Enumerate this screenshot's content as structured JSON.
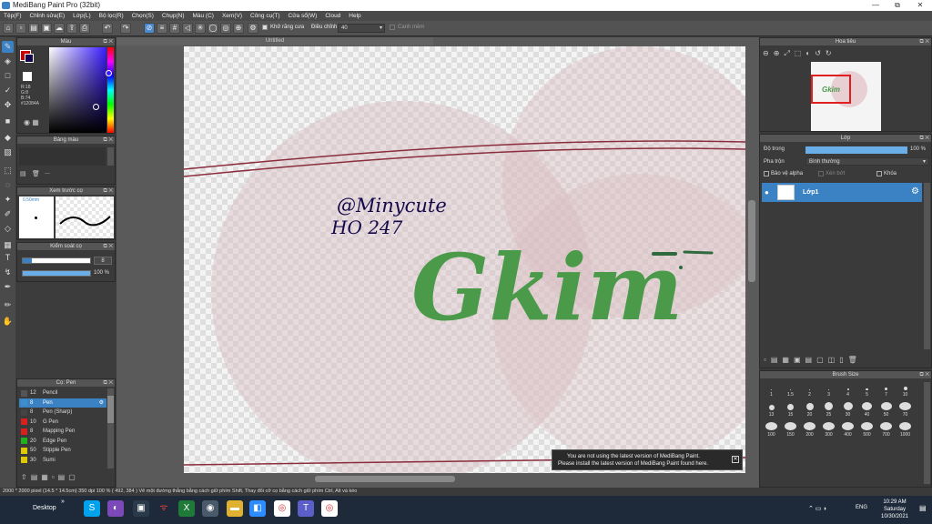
{
  "window": {
    "title": "MediBang Paint Pro (32bit)",
    "controls": [
      "—",
      "⧉",
      "✕"
    ]
  },
  "menu": [
    "Tệp(F)",
    "Chỉnh sửa(E)",
    "Lớp(L)",
    "Bộ lọc(R)",
    "Chọn(S)",
    "Chụp(N)",
    "Màu (C)",
    "Xem(V)",
    "Công cụ(T)",
    "Cửa sổ(W)",
    "Cloud",
    "Help"
  ],
  "toolbar": {
    "antialias_label": "Khử răng cưa",
    "adjust_label": "Điều chỉnh",
    "adjust_value": "40",
    "smooth_label": "Canh mềm"
  },
  "canvas": {
    "tab_title": "Untitled"
  },
  "color_panel": {
    "title": "Màu",
    "r": "R:18",
    "g": "G:8",
    "b": "B:74",
    "hex": "#12084A"
  },
  "palette_panel": {
    "title": "Bảng màu",
    "dash": "---"
  },
  "preview_panel": {
    "title": "Xem trước cọ",
    "size": "0.50mm"
  },
  "control_panel": {
    "title": "Kiểm soát cọ",
    "size_value": "8",
    "opacity_value": "100 %",
    "opacity_fraction": 1.0
  },
  "brush_list": {
    "title": "Cọ: Pen",
    "items": [
      {
        "size": "12",
        "name": "Pencil",
        "color": "#555555",
        "selected": false
      },
      {
        "size": "8",
        "name": "Pen",
        "color": "#3c8ecc",
        "selected": true
      },
      {
        "size": "8",
        "name": "Pen (Sharp)",
        "color": "#444444",
        "selected": false
      },
      {
        "size": "10",
        "name": "G Pen",
        "color": "#d82020",
        "selected": false
      },
      {
        "size": "8",
        "name": "Mapping Pen",
        "color": "#d82020",
        "selected": false
      },
      {
        "size": "20",
        "name": "Edge Pen",
        "color": "#20b020",
        "selected": false
      },
      {
        "size": "50",
        "name": "Stipple Pen",
        "color": "#e0c800",
        "selected": false
      },
      {
        "size": "30",
        "name": "Sumi",
        "color": "#e0c800",
        "selected": false
      }
    ]
  },
  "navigator": {
    "title": "Hoa tiêu"
  },
  "layers": {
    "title": "Lớp",
    "opacity_label": "Độ trong",
    "opacity_value": "100 %",
    "opacity_fraction": 1.0,
    "blend_label": "Pha trộn",
    "blend_value": "Bình thường",
    "protect_alpha": "Bảo vệ alpha",
    "clipping": "Xén bớt",
    "lock": "Khóa",
    "layer_name": "Lớp1"
  },
  "brush_size": {
    "title": "Brush Size",
    "sizes": [
      "1",
      "1.5",
      "2",
      "3",
      "4",
      "5",
      "7",
      "10",
      "13",
      "15",
      "20",
      "25",
      "30",
      "40",
      "50",
      "70",
      "100",
      "150",
      "200",
      "300",
      "400",
      "500",
      "700",
      "1000"
    ]
  },
  "notice": {
    "line1": "You are not using the latest version of MediBang Paint.",
    "line2": "Please install the latest version of MediBang Paint found here."
  },
  "statusbar": {
    "text": "2000 * 2000 pixel  (14.5 * 14.5cm)  350 dpi  100 %  ( 492, 384 )  Vẽ một đường thẳng bằng cách giữ phím Shift, Thay đổi cỡ cọ bằng cách giữ phím Ctrl, Alt và kéo"
  },
  "taskbar": {
    "desktop": "Desktop",
    "lang": "ENG",
    "time": "10:29 AM",
    "day": "Saturday",
    "date": "10/30/2021"
  },
  "artwork": {
    "handle": "@Minycute",
    "code": "HO 247",
    "title": "Gkim",
    "title_color": "#4a9a4a",
    "ink_color": "#12084A"
  }
}
